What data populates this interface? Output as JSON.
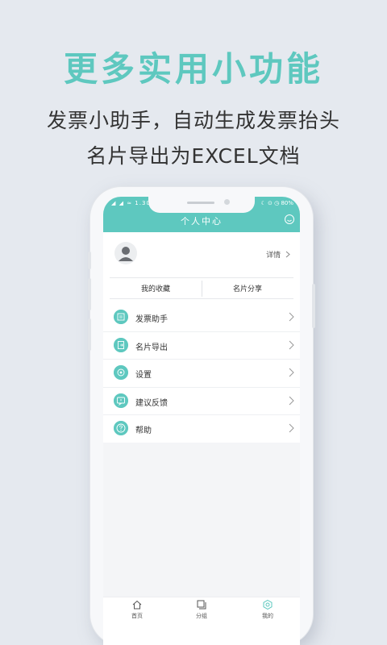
{
  "promo": {
    "title": "更多实用小功能",
    "line1": "发票小助手，自动生成发票抬头",
    "line2": "名片导出为EXCEL文档"
  },
  "status_bar": {
    "carrier": "◢ ◢ ≈ 1.30K",
    "right": "☾ ⊙ ◷ 80%"
  },
  "header": {
    "title": "个人中心",
    "icon": "smiley-icon"
  },
  "profile": {
    "details_label": "详情"
  },
  "tabs": [
    "我的收藏",
    "名片分享"
  ],
  "menu": [
    {
      "label": "发票助手",
      "icon": "invoice-icon"
    },
    {
      "label": "名片导出",
      "icon": "export-icon"
    },
    {
      "label": "设置",
      "icon": "settings-icon"
    },
    {
      "label": "建议反馈",
      "icon": "feedback-icon"
    },
    {
      "label": "帮助",
      "icon": "help-icon"
    }
  ],
  "bottom_nav": [
    {
      "label": "首页",
      "icon": "home-icon"
    },
    {
      "label": "分组",
      "icon": "group-icon"
    },
    {
      "label": "我的",
      "icon": "profile-icon",
      "active": true
    }
  ],
  "colors": {
    "accent": "#5ec8bf",
    "background": "#e5e9ef"
  }
}
